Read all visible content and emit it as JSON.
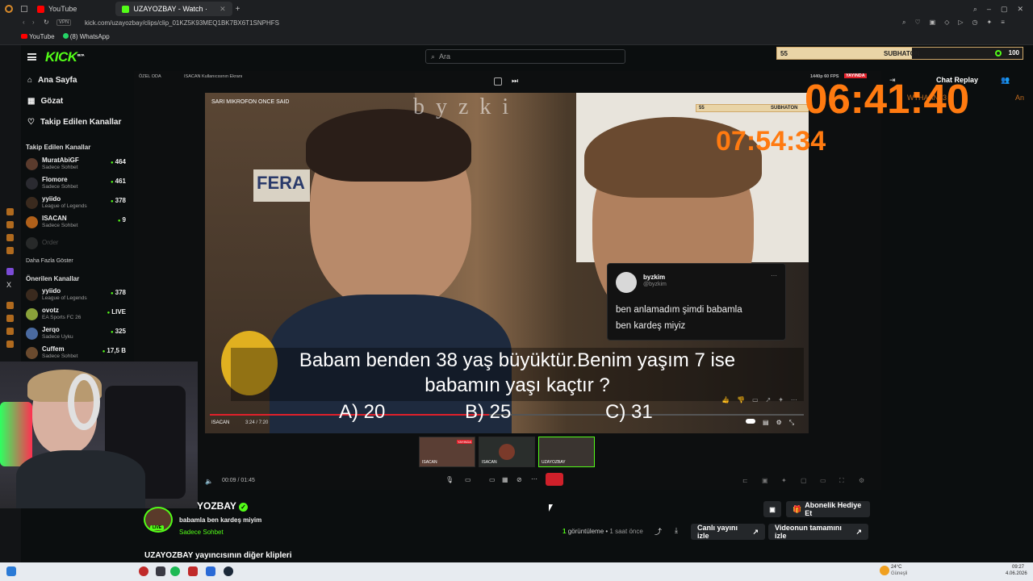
{
  "browser": {
    "tabs": [
      {
        "label": "YouTube",
        "color": "#ff0000"
      },
      {
        "label": "UZAYOZBAY - Watch ·",
        "color": "#53fc18"
      }
    ],
    "url": "kick.com/uzayozbay/clips/clip_01KZ5K93MEQ1BK7BX6T1SNPHFS",
    "vpn": "VPN",
    "bookmarks": [
      "YouTube",
      "(8) WhatsApp"
    ]
  },
  "kick": {
    "logo": "KICK",
    "logo_badge": "BETA",
    "search_placeholder": "Ara",
    "nav": [
      "Ana Sayfa",
      "Gözat",
      "Takip Edilen Kanallar"
    ],
    "followed_title": "Takip Edilen Kanallar",
    "followed": [
      {
        "name": "MuratAbiGF",
        "sub": "Sadece Sohbet",
        "viewers": "464"
      },
      {
        "name": "Flomore",
        "sub": "Sadece Sohbet",
        "viewers": "461"
      },
      {
        "name": "yyiido",
        "sub": "League of Legends",
        "viewers": "378"
      },
      {
        "name": "ISACAN",
        "sub": "Sadece Sohbet",
        "viewers": "9"
      },
      {
        "name": "Order",
        "sub": "",
        "viewers": ""
      }
    ],
    "more_label": "Daha Fazla Göster",
    "recommended_title": "Önerilen Kanallar",
    "recommended": [
      {
        "name": "yyiido",
        "sub": "League of Legends",
        "viewers": "378"
      },
      {
        "name": "ovotz",
        "sub": "EA Sports FC 26",
        "viewers": "LIVE"
      },
      {
        "name": "Jerqo",
        "sub": "Sadece Uyku",
        "viewers": "325"
      },
      {
        "name": "Cuffem",
        "sub": "Sadece Sohbet",
        "viewers": "17,5 B"
      }
    ]
  },
  "stream": {
    "top_left": [
      "ÖZEL ODA",
      "ISACAN Kullanıcısının Ekranı"
    ],
    "top_right": [
      "1440p 60 FPS",
      "YAYINDA"
    ],
    "video_caption": "SARI MIKROFON ONCE SAID",
    "watermark": "byzki",
    "shop_sign": "FERA",
    "tweet_user": "byzkim",
    "tweet_handle": "@byzkim",
    "tweet_text_1": "ben anlamadım şimdi babamla",
    "tweet_text_2": "ben kardeş miyiz",
    "subtitle_line1": "Babam benden 38 yaş büyüktür.Benim yaşım 7 ise",
    "subtitle_line2": "babamın yaşı kaçtır ?",
    "answer_a": "A) 20",
    "answer_b": "B) 25",
    "answer_c": "C) 31",
    "inner_time": "3:24 / 7:20",
    "inner_channel": "ISACAN"
  },
  "overlay": {
    "timer_main": "06:41:40",
    "timer_secondary": "07:54:34",
    "subathon_label": "SUBHATON",
    "subathon_left": "55",
    "subathon_right": "100",
    "subathon_progress": 0.55,
    "inner_subathon_left": "55",
    "inner_subathon_label": "SUBHATON"
  },
  "thumbs": [
    {
      "label": "ISACAN",
      "badge": "YAYINDA"
    },
    {
      "label": "ISACAN",
      "badge": ""
    },
    {
      "label": "UZAYOZBAY",
      "badge": ""
    }
  ],
  "player": {
    "time_current": "00:09",
    "time_total": "01:45"
  },
  "channel": {
    "name": "UZAYOZBAY",
    "name_visible": "YOZBAY",
    "clip_title": "babamla ben kardeş miyim",
    "category": "Sadece Sohbet",
    "live_badge": "LIVE",
    "views_count": "1",
    "views_label": "görüntüleme",
    "time_ago": "1 saat önce",
    "subscribe_gift": "Abonelik Hediye Et",
    "watch_live": "Canlı yayını izle",
    "watch_full": "Videonun tamamını izle",
    "more_clips": "UZAYOZBAY yayıncısının diğer klipleri"
  },
  "chat": {
    "title": "Chat Replay",
    "partial_name": "WTHAAN13",
    "partial_right": "An"
  },
  "taskbar": {
    "weather_temp": "24°C",
    "weather_desc": "Güneşli",
    "clock_time": "09:27",
    "clock_date": "4.06.2026"
  },
  "colors": {
    "kick_green": "#53fc18",
    "timer_orange": "#ff7a10",
    "bg": "#0b0e0f"
  }
}
